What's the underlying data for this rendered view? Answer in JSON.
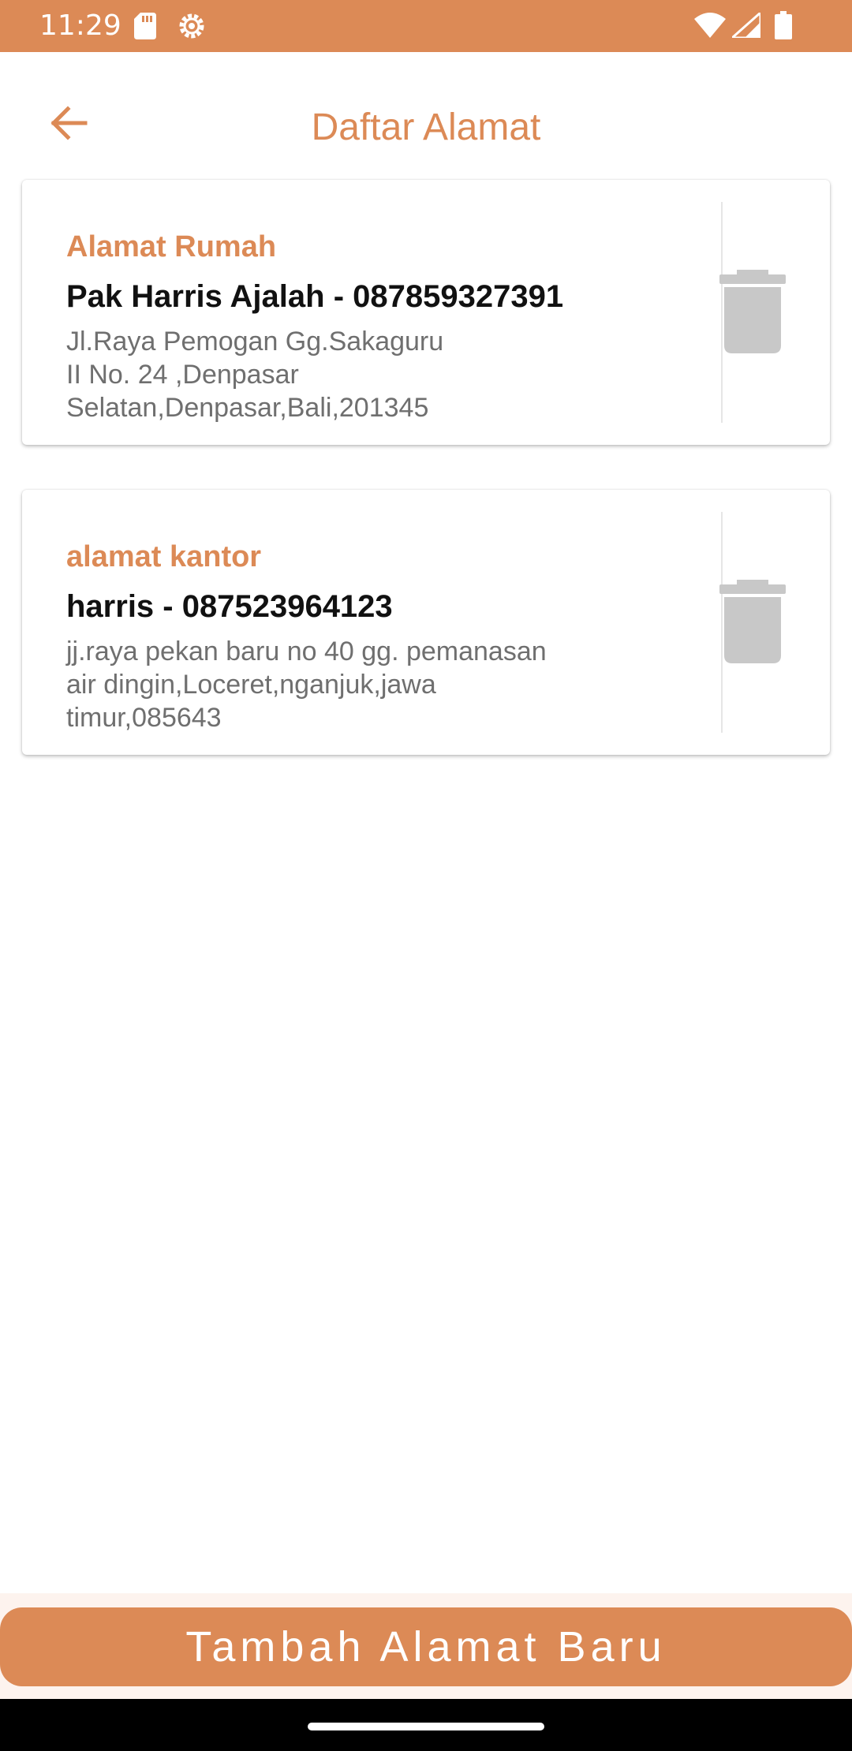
{
  "status_bar": {
    "time": "11:29",
    "icons": [
      "sd-card-icon",
      "gear-icon",
      "wifi-icon",
      "signal-icon",
      "battery-icon"
    ]
  },
  "header": {
    "title": "Daftar Alamat",
    "back_icon": "arrow-left-icon"
  },
  "addresses": [
    {
      "label": "Alamat Rumah",
      "name_phone": "Pak Harris Ajalah - 087859327391",
      "address_lines": [
        "Jl.Raya Pemogan Gg.Sakaguru",
        "II No. 24 ,Denpasar",
        "Selatan,Denpasar,Bali,201345"
      ]
    },
    {
      "label": "alamat kantor",
      "name_phone": "harris - 087523964123",
      "address_lines": [
        "jj.raya pekan baru no 40 gg. pemanasan",
        "air dingin,Loceret,nganjuk,jawa",
        "timur,085643"
      ]
    }
  ],
  "footer": {
    "add_button_label": "Tambah Alamat Baru"
  },
  "colors": {
    "accent": "#dc8a56",
    "trash": "#c8c8c8",
    "address_text": "#6f6f6f"
  }
}
